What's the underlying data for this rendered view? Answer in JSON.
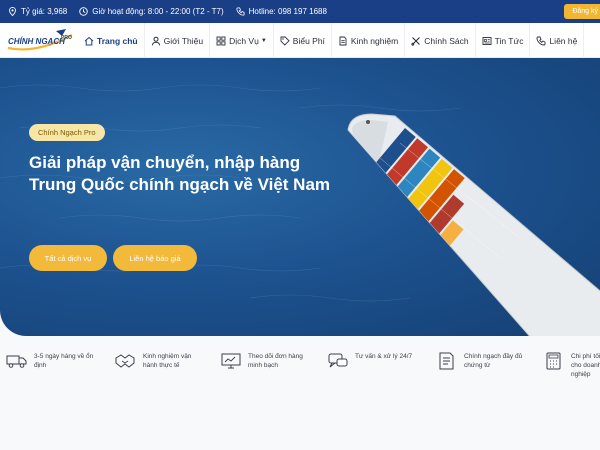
{
  "topbar": {
    "visits": "Tỷ giá: 3,968",
    "hours": "Giờ hoạt động: 8:00 - 22:00 (T2 - T7)",
    "hotline": "Hotline: 098 197 1688",
    "register_label": "Đăng ký"
  },
  "logo": {
    "text": "CHÍNH NGẠCH",
    "tag": "PRO"
  },
  "nav": {
    "items": [
      {
        "label": "Trang chủ",
        "icon": "home-icon"
      },
      {
        "label": "Giới Thiệu",
        "icon": "user-icon"
      },
      {
        "label": "Dịch Vụ",
        "icon": "grid-icon"
      },
      {
        "label": "Biểu Phí",
        "icon": "tag-icon"
      },
      {
        "label": "Kinh nghiệm",
        "icon": "document-icon"
      },
      {
        "label": "Chính Sách",
        "icon": "tools-icon"
      },
      {
        "label": "Tin Tức",
        "icon": "news-icon"
      },
      {
        "label": "Liên hệ",
        "icon": "phone-icon"
      }
    ]
  },
  "hero": {
    "badge": "Chính Ngạch Pro",
    "headline": "Giải pháp vận chuyển, nhập hàng Trung Quốc chính ngạch về Việt Nam",
    "btn_services": "Tất cả dịch vụ",
    "btn_contact": "Liên hệ báo giá"
  },
  "features": [
    {
      "text": "3-5 ngày hàng về ổn định",
      "icon": "truck-icon"
    },
    {
      "text": "Kinh nghiệm vận hành thực tế",
      "icon": "handshake-icon"
    },
    {
      "text": "Theo dõi đơn hàng minh bạch",
      "icon": "monitor-icon"
    },
    {
      "text": "Tư vấn & xử lý 24/7",
      "icon": "chat-icon"
    },
    {
      "text": "Chính ngạch đầy đủ chứng từ",
      "icon": "invoice-icon"
    },
    {
      "text": "Chi phí tối ưu cho doanh nghiệp",
      "icon": "calculator-icon"
    }
  ],
  "colors": {
    "navy": "#1b3f86",
    "accent": "#f3b93a",
    "ocean": "#1d5390"
  }
}
